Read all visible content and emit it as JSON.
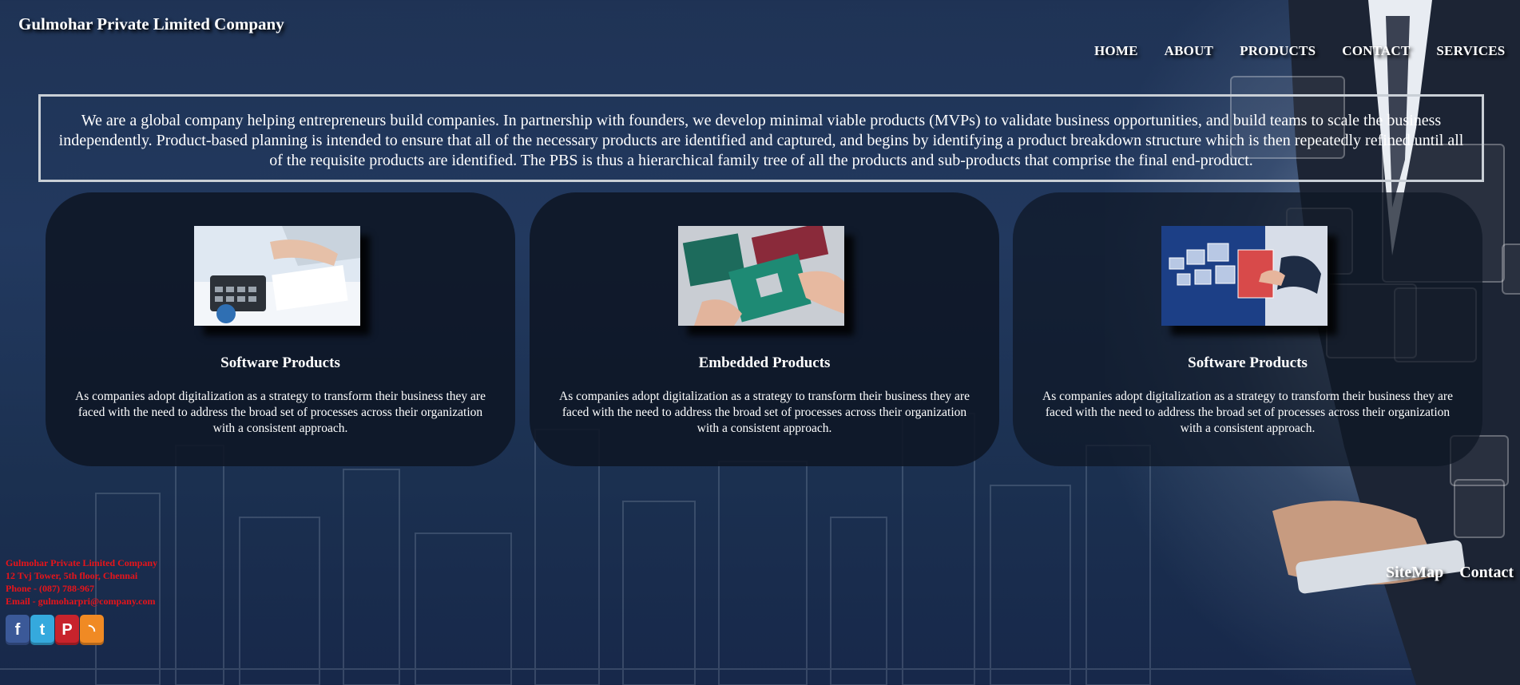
{
  "header": {
    "brand": "Gulmohar Private Limited Company"
  },
  "nav": {
    "items": [
      {
        "label": "HOME"
      },
      {
        "label": "ABOUT"
      },
      {
        "label": "PRODUCTS"
      },
      {
        "label": "CONTACT"
      },
      {
        "label": "SERVICES"
      }
    ]
  },
  "about": {
    "text": "We are a global company helping entrepreneurs build companies. In partnership with founders, we develop minimal viable products (MVPs) to validate business opportunities, and build teams to scale the business independently. Product-based planning is intended to ensure that all of the necessary products are identified and captured, and begins by identifying a product breakdown structure which is then repeatedly refined until all of the requisite products are identified. The PBS is thus a hierarchical family tree of all the products and sub-products that comprise the final end-product."
  },
  "cards": [
    {
      "title": "Software Products",
      "description": "As companies adopt digitalization as a strategy to transform their business they are faced with the need to address the broad set of processes across their organization with a consistent approach.",
      "image": "office-desk-calculator-photo"
    },
    {
      "title": "Embedded Products",
      "description": "As companies adopt digitalization as a strategy to transform their business they are faced with the need to address the broad set of processes across their organization with a consistent approach.",
      "image": "circuit-boards-hands-photo"
    },
    {
      "title": "Software Products",
      "description": "As companies adopt digitalization as a strategy to transform their business they are faced with the need to address the broad set of processes across their organization with a consistent approach.",
      "image": "digital-screens-hand-photo"
    }
  ],
  "footer": {
    "company": "Gulmohar Private Limited Company",
    "address": "12 Tvj Tower, 5th floor, Chennai",
    "phone": "Phone - (087) 788-967",
    "email": "Email - gulmoharpri@company.com",
    "links": [
      {
        "label": "SiteMap"
      },
      {
        "label": "Contact"
      }
    ],
    "social": [
      {
        "icon": "facebook-icon",
        "glyph": "f",
        "color": "#3b5998"
      },
      {
        "icon": "twitter-icon",
        "glyph": "t",
        "color": "#35a9dd"
      },
      {
        "icon": "pinterest-icon",
        "glyph": "P",
        "color": "#c8232c"
      },
      {
        "icon": "rss-icon",
        "glyph": "◝",
        "color": "#f08a24"
      }
    ]
  },
  "colors": {
    "footer_text": "#e8141a",
    "card_bg": "#0e1624",
    "page_bg": "#1f3355"
  }
}
